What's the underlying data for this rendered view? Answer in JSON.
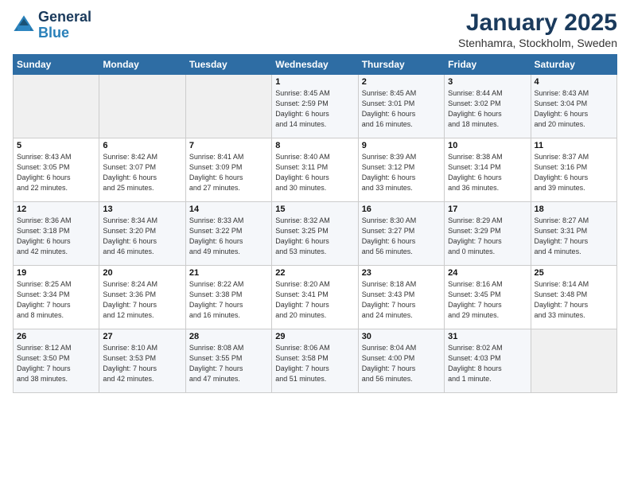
{
  "logo": {
    "line1": "General",
    "line2": "Blue"
  },
  "title": "January 2025",
  "subtitle": "Stenhamra, Stockholm, Sweden",
  "weekdays": [
    "Sunday",
    "Monday",
    "Tuesday",
    "Wednesday",
    "Thursday",
    "Friday",
    "Saturday"
  ],
  "weeks": [
    [
      {
        "day": "",
        "info": ""
      },
      {
        "day": "",
        "info": ""
      },
      {
        "day": "",
        "info": ""
      },
      {
        "day": "1",
        "info": "Sunrise: 8:45 AM\nSunset: 2:59 PM\nDaylight: 6 hours\nand 14 minutes."
      },
      {
        "day": "2",
        "info": "Sunrise: 8:45 AM\nSunset: 3:01 PM\nDaylight: 6 hours\nand 16 minutes."
      },
      {
        "day": "3",
        "info": "Sunrise: 8:44 AM\nSunset: 3:02 PM\nDaylight: 6 hours\nand 18 minutes."
      },
      {
        "day": "4",
        "info": "Sunrise: 8:43 AM\nSunset: 3:04 PM\nDaylight: 6 hours\nand 20 minutes."
      }
    ],
    [
      {
        "day": "5",
        "info": "Sunrise: 8:43 AM\nSunset: 3:05 PM\nDaylight: 6 hours\nand 22 minutes."
      },
      {
        "day": "6",
        "info": "Sunrise: 8:42 AM\nSunset: 3:07 PM\nDaylight: 6 hours\nand 25 minutes."
      },
      {
        "day": "7",
        "info": "Sunrise: 8:41 AM\nSunset: 3:09 PM\nDaylight: 6 hours\nand 27 minutes."
      },
      {
        "day": "8",
        "info": "Sunrise: 8:40 AM\nSunset: 3:11 PM\nDaylight: 6 hours\nand 30 minutes."
      },
      {
        "day": "9",
        "info": "Sunrise: 8:39 AM\nSunset: 3:12 PM\nDaylight: 6 hours\nand 33 minutes."
      },
      {
        "day": "10",
        "info": "Sunrise: 8:38 AM\nSunset: 3:14 PM\nDaylight: 6 hours\nand 36 minutes."
      },
      {
        "day": "11",
        "info": "Sunrise: 8:37 AM\nSunset: 3:16 PM\nDaylight: 6 hours\nand 39 minutes."
      }
    ],
    [
      {
        "day": "12",
        "info": "Sunrise: 8:36 AM\nSunset: 3:18 PM\nDaylight: 6 hours\nand 42 minutes."
      },
      {
        "day": "13",
        "info": "Sunrise: 8:34 AM\nSunset: 3:20 PM\nDaylight: 6 hours\nand 46 minutes."
      },
      {
        "day": "14",
        "info": "Sunrise: 8:33 AM\nSunset: 3:22 PM\nDaylight: 6 hours\nand 49 minutes."
      },
      {
        "day": "15",
        "info": "Sunrise: 8:32 AM\nSunset: 3:25 PM\nDaylight: 6 hours\nand 53 minutes."
      },
      {
        "day": "16",
        "info": "Sunrise: 8:30 AM\nSunset: 3:27 PM\nDaylight: 6 hours\nand 56 minutes."
      },
      {
        "day": "17",
        "info": "Sunrise: 8:29 AM\nSunset: 3:29 PM\nDaylight: 7 hours\nand 0 minutes."
      },
      {
        "day": "18",
        "info": "Sunrise: 8:27 AM\nSunset: 3:31 PM\nDaylight: 7 hours\nand 4 minutes."
      }
    ],
    [
      {
        "day": "19",
        "info": "Sunrise: 8:25 AM\nSunset: 3:34 PM\nDaylight: 7 hours\nand 8 minutes."
      },
      {
        "day": "20",
        "info": "Sunrise: 8:24 AM\nSunset: 3:36 PM\nDaylight: 7 hours\nand 12 minutes."
      },
      {
        "day": "21",
        "info": "Sunrise: 8:22 AM\nSunset: 3:38 PM\nDaylight: 7 hours\nand 16 minutes."
      },
      {
        "day": "22",
        "info": "Sunrise: 8:20 AM\nSunset: 3:41 PM\nDaylight: 7 hours\nand 20 minutes."
      },
      {
        "day": "23",
        "info": "Sunrise: 8:18 AM\nSunset: 3:43 PM\nDaylight: 7 hours\nand 24 minutes."
      },
      {
        "day": "24",
        "info": "Sunrise: 8:16 AM\nSunset: 3:45 PM\nDaylight: 7 hours\nand 29 minutes."
      },
      {
        "day": "25",
        "info": "Sunrise: 8:14 AM\nSunset: 3:48 PM\nDaylight: 7 hours\nand 33 minutes."
      }
    ],
    [
      {
        "day": "26",
        "info": "Sunrise: 8:12 AM\nSunset: 3:50 PM\nDaylight: 7 hours\nand 38 minutes."
      },
      {
        "day": "27",
        "info": "Sunrise: 8:10 AM\nSunset: 3:53 PM\nDaylight: 7 hours\nand 42 minutes."
      },
      {
        "day": "28",
        "info": "Sunrise: 8:08 AM\nSunset: 3:55 PM\nDaylight: 7 hours\nand 47 minutes."
      },
      {
        "day": "29",
        "info": "Sunrise: 8:06 AM\nSunset: 3:58 PM\nDaylight: 7 hours\nand 51 minutes."
      },
      {
        "day": "30",
        "info": "Sunrise: 8:04 AM\nSunset: 4:00 PM\nDaylight: 7 hours\nand 56 minutes."
      },
      {
        "day": "31",
        "info": "Sunrise: 8:02 AM\nSunset: 4:03 PM\nDaylight: 8 hours\nand 1 minute."
      },
      {
        "day": "",
        "info": ""
      }
    ]
  ]
}
